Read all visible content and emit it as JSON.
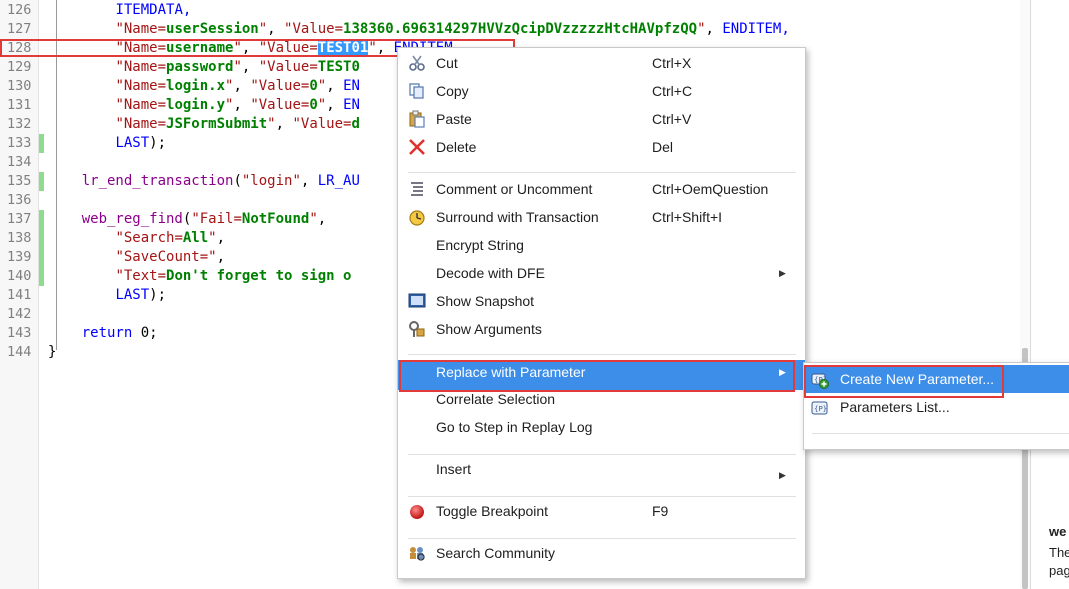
{
  "editor": {
    "lines": [
      {
        "no": "126",
        "indent": "        ",
        "tokens": [
          {
            "t": "ITEMDATA,",
            "c": "kw"
          }
        ]
      },
      {
        "no": "127",
        "indent": "        ",
        "tokens": [
          {
            "t": "\"Name=",
            "c": "str"
          },
          {
            "t": "userSession",
            "c": "pv"
          },
          {
            "t": "\"",
            "c": "str"
          },
          {
            "t": ", ",
            "c": "plain"
          },
          {
            "t": "\"Value=",
            "c": "str"
          },
          {
            "t": "138360.696314297HVVzQcipDVzzzzzHtcHAVpfzQQ",
            "c": "pv"
          },
          {
            "t": "\"",
            "c": "str"
          },
          {
            "t": ", ",
            "c": "plain"
          },
          {
            "t": "ENDITEM,",
            "c": "kw"
          }
        ]
      },
      {
        "no": "128",
        "indent": "        ",
        "tokens": [
          {
            "t": "\"Name=",
            "c": "str"
          },
          {
            "t": "username",
            "c": "pv"
          },
          {
            "t": "\"",
            "c": "str"
          },
          {
            "t": ", ",
            "c": "plain"
          },
          {
            "t": "\"Value=",
            "c": "str"
          },
          {
            "t": "TEST01",
            "c": "sel"
          },
          {
            "t": "\"",
            "c": "str"
          },
          {
            "t": ", ",
            "c": "plain"
          },
          {
            "t": "ENDITEM,",
            "c": "kw"
          }
        ]
      },
      {
        "no": "129",
        "indent": "        ",
        "tokens": [
          {
            "t": "\"Name=",
            "c": "str"
          },
          {
            "t": "password",
            "c": "pv"
          },
          {
            "t": "\"",
            "c": "str"
          },
          {
            "t": ", ",
            "c": "plain"
          },
          {
            "t": "\"Value=",
            "c": "str"
          },
          {
            "t": "TEST0",
            "c": "pv"
          }
        ]
      },
      {
        "no": "130",
        "indent": "        ",
        "tokens": [
          {
            "t": "\"Name=",
            "c": "str"
          },
          {
            "t": "login.x",
            "c": "pv"
          },
          {
            "t": "\"",
            "c": "str"
          },
          {
            "t": ", ",
            "c": "plain"
          },
          {
            "t": "\"Value=",
            "c": "str"
          },
          {
            "t": "0",
            "c": "pv"
          },
          {
            "t": "\"",
            "c": "str"
          },
          {
            "t": ", ",
            "c": "plain"
          },
          {
            "t": "EN",
            "c": "kw"
          }
        ]
      },
      {
        "no": "131",
        "indent": "        ",
        "tokens": [
          {
            "t": "\"Name=",
            "c": "str"
          },
          {
            "t": "login.y",
            "c": "pv"
          },
          {
            "t": "\"",
            "c": "str"
          },
          {
            "t": ", ",
            "c": "plain"
          },
          {
            "t": "\"Value=",
            "c": "str"
          },
          {
            "t": "0",
            "c": "pv"
          },
          {
            "t": "\"",
            "c": "str"
          },
          {
            "t": ", ",
            "c": "plain"
          },
          {
            "t": "EN",
            "c": "kw"
          }
        ]
      },
      {
        "no": "132",
        "indent": "        ",
        "tokens": [
          {
            "t": "\"Name=",
            "c": "str"
          },
          {
            "t": "JSFormSubmit",
            "c": "pv"
          },
          {
            "t": "\"",
            "c": "str"
          },
          {
            "t": ", ",
            "c": "plain"
          },
          {
            "t": "\"Value=",
            "c": "str"
          },
          {
            "t": "d",
            "c": "pv"
          }
        ]
      },
      {
        "no": "133",
        "indent": "        ",
        "tokens": [
          {
            "t": "LAST",
            "c": "kw"
          },
          {
            "t": ");",
            "c": "plain"
          }
        ]
      },
      {
        "no": "134",
        "indent": "",
        "tokens": []
      },
      {
        "no": "135",
        "indent": "    ",
        "tokens": [
          {
            "t": "lr_end_transaction",
            "c": "fn"
          },
          {
            "t": "(",
            "c": "plain"
          },
          {
            "t": "\"login\"",
            "c": "str"
          },
          {
            "t": ", ",
            "c": "plain"
          },
          {
            "t": "LR_AU",
            "c": "kw"
          }
        ]
      },
      {
        "no": "136",
        "indent": "",
        "tokens": []
      },
      {
        "no": "137",
        "indent": "    ",
        "tokens": [
          {
            "t": "web_reg_find",
            "c": "fn"
          },
          {
            "t": "(",
            "c": "plain"
          },
          {
            "t": "\"Fail=",
            "c": "str"
          },
          {
            "t": "NotFound",
            "c": "pv"
          },
          {
            "t": "\"",
            "c": "str"
          },
          {
            "t": ",",
            "c": "plain"
          }
        ]
      },
      {
        "no": "138",
        "indent": "        ",
        "tokens": [
          {
            "t": "\"Search=",
            "c": "str"
          },
          {
            "t": "All",
            "c": "pv"
          },
          {
            "t": "\"",
            "c": "str"
          },
          {
            "t": ",",
            "c": "plain"
          }
        ]
      },
      {
        "no": "139",
        "indent": "        ",
        "tokens": [
          {
            "t": "\"SaveCount=",
            "c": "str"
          },
          {
            "t": "\"",
            "c": "str"
          },
          {
            "t": ",",
            "c": "plain"
          }
        ]
      },
      {
        "no": "140",
        "indent": "        ",
        "tokens": [
          {
            "t": "\"Text=",
            "c": "str"
          },
          {
            "t": "Don't forget to sign o",
            "c": "pv"
          }
        ]
      },
      {
        "no": "141",
        "indent": "        ",
        "tokens": [
          {
            "t": "LAST",
            "c": "kw"
          },
          {
            "t": ");",
            "c": "plain"
          }
        ]
      },
      {
        "no": "142",
        "indent": "",
        "tokens": []
      },
      {
        "no": "143",
        "indent": "    ",
        "tokens": [
          {
            "t": "return ",
            "c": "kw"
          },
          {
            "t": "0;",
            "c": "plain"
          }
        ]
      },
      {
        "no": "144",
        "indent": "",
        "tokens": [
          {
            "t": "}",
            "c": "plain"
          }
        ]
      }
    ]
  },
  "context_menu": {
    "items": [
      {
        "id": "cut",
        "label": "Cut",
        "shortcut": "Ctrl+X",
        "icon": "scissors-icon"
      },
      {
        "id": "copy",
        "label": "Copy",
        "shortcut": "Ctrl+C",
        "icon": "copy-icon"
      },
      {
        "id": "paste",
        "label": "Paste",
        "shortcut": "Ctrl+V",
        "icon": "paste-icon"
      },
      {
        "id": "delete",
        "label": "Delete",
        "shortcut": "Del",
        "icon": "delete-icon"
      },
      {
        "id": "comment",
        "label": "Comment or Uncomment",
        "shortcut": "Ctrl+OemQuestion",
        "icon": "comment-icon"
      },
      {
        "id": "surround",
        "label": "Surround with Transaction",
        "shortcut": "Ctrl+Shift+I",
        "icon": "transaction-icon"
      },
      {
        "id": "encrypt",
        "label": "Encrypt String",
        "shortcut": "",
        "icon": ""
      },
      {
        "id": "decode",
        "label": "Decode with DFE",
        "shortcut": "",
        "icon": "",
        "submenu": true
      },
      {
        "id": "snapshot",
        "label": "Show Snapshot",
        "shortcut": "",
        "icon": "snapshot-icon"
      },
      {
        "id": "arguments",
        "label": "Show Arguments",
        "shortcut": "",
        "icon": "arguments-icon"
      },
      {
        "id": "replace",
        "label": "Replace with Parameter",
        "shortcut": "",
        "icon": "",
        "submenu": true,
        "highlighted": true
      },
      {
        "id": "correlate",
        "label": "Correlate Selection",
        "shortcut": "",
        "icon": ""
      },
      {
        "id": "goto",
        "label": "Go to Step in Replay Log",
        "shortcut": "",
        "icon": ""
      },
      {
        "id": "insert",
        "label": "Insert",
        "shortcut": "",
        "icon": "",
        "submenu": true
      },
      {
        "id": "breakpoint",
        "label": "Toggle Breakpoint",
        "shortcut": "F9",
        "icon": "breakpoint-icon"
      },
      {
        "id": "search",
        "label": "Search Community",
        "shortcut": "",
        "icon": "community-icon"
      }
    ]
  },
  "submenu": {
    "items": [
      {
        "id": "create",
        "label": "Create New Parameter...",
        "icon": "create-parameter-icon",
        "highlighted": true
      },
      {
        "id": "list",
        "label": "Parameters List...",
        "icon": "parameter-list-icon"
      }
    ]
  },
  "right_panel": {
    "title": "we",
    "line1": "The",
    "line2": "pag"
  },
  "colors": {
    "highlight": "#3c8ee8",
    "annotation": "#e03a3a",
    "selection": "#3399ff"
  }
}
